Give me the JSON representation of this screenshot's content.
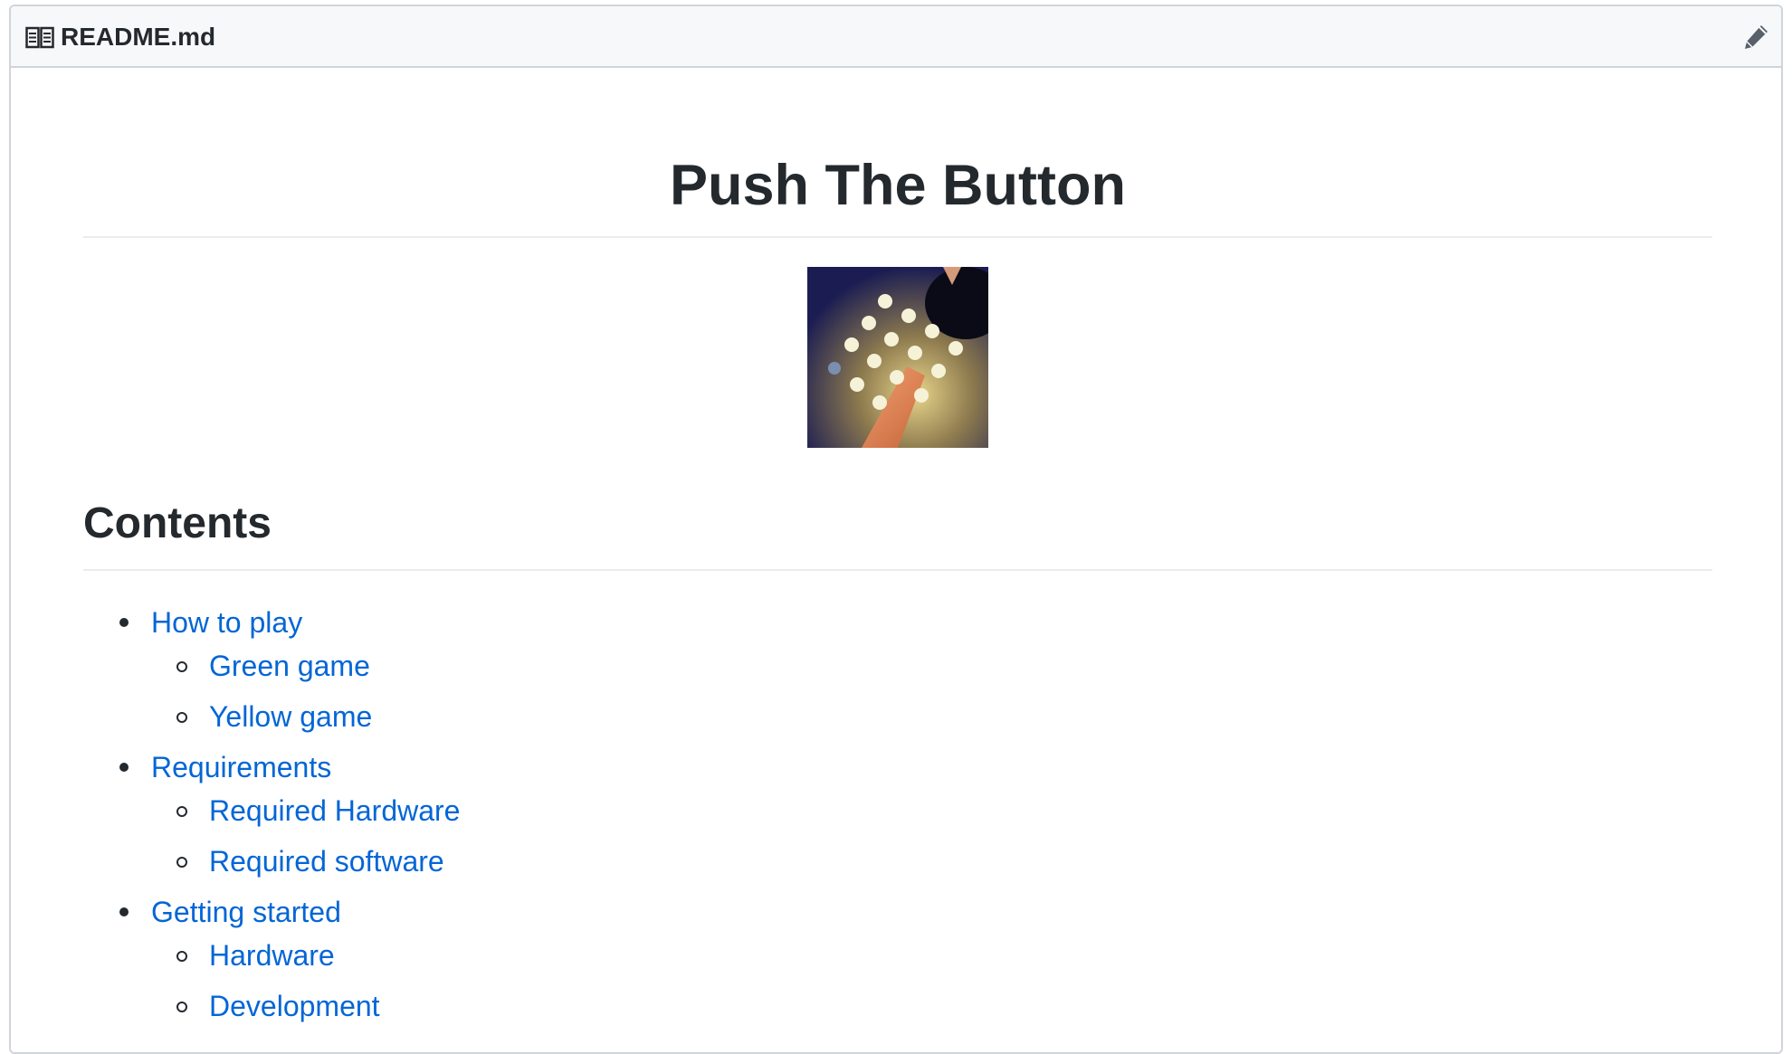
{
  "file": {
    "name": "README.md",
    "icon": "book-icon",
    "edit_icon": "pencil-icon"
  },
  "readme": {
    "title": "Push The Button",
    "image_description_icon": "game-photo",
    "contents_heading": "Contents",
    "toc": [
      {
        "label": "How to play",
        "children": [
          "Green game",
          "Yellow game"
        ]
      },
      {
        "label": "Requirements",
        "children": [
          "Required Hardware",
          "Required software"
        ]
      },
      {
        "label": "Getting started",
        "children": [
          "Hardware",
          "Development"
        ]
      }
    ]
  },
  "colors": {
    "link": "#0366d6",
    "text": "#24292e",
    "header_bg": "#f6f8fa",
    "border": "#d1d5da"
  }
}
